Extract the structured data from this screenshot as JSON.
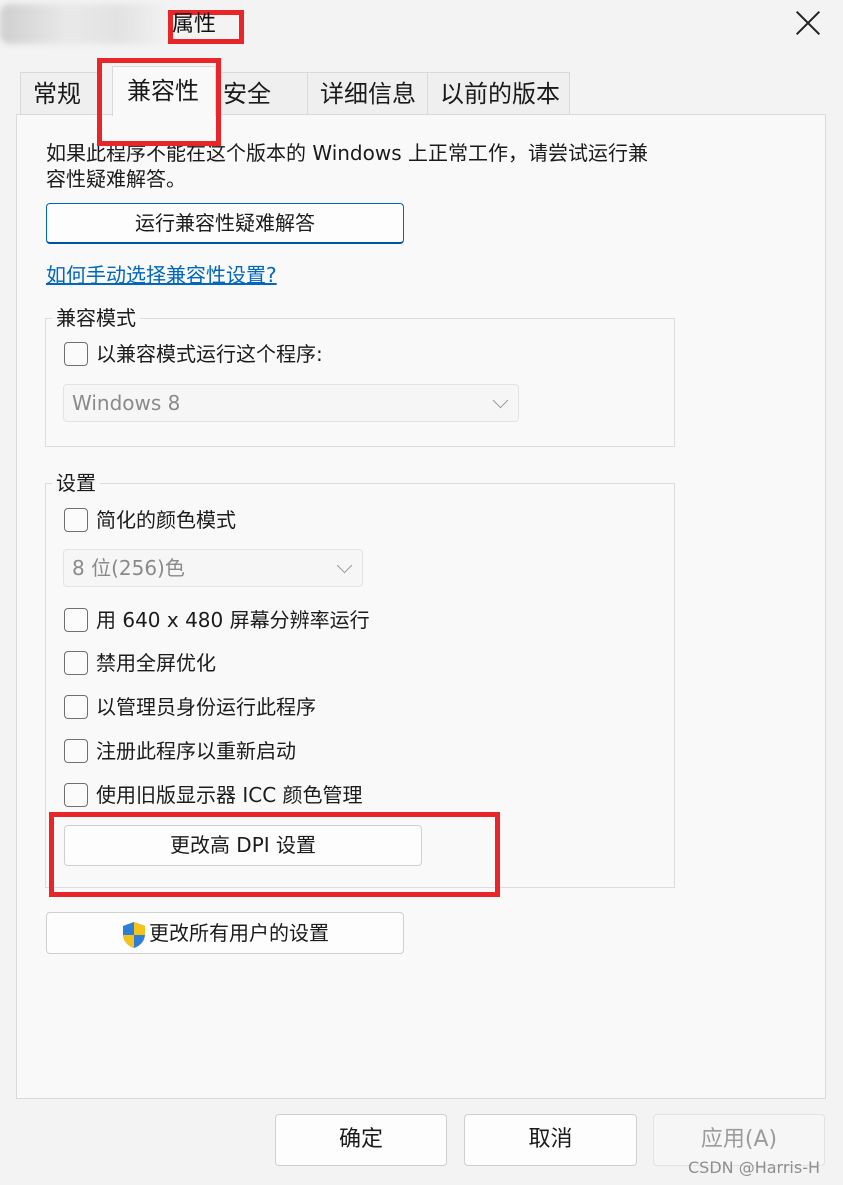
{
  "window": {
    "title": "属性"
  },
  "tabs": [
    {
      "label": "常规"
    },
    {
      "label": "兼容性"
    },
    {
      "label": "安全"
    },
    {
      "label": "详细信息"
    },
    {
      "label": "以前的版本"
    }
  ],
  "intro": {
    "line1": "如果此程序不能在这个版本的 Windows 上正常工作，请尝试运行兼",
    "line2": "容性疑难解答。"
  },
  "troubleshoot_button": "运行兼容性疑难解答",
  "manual_link": "如何手动选择兼容性设置?",
  "compat_mode": {
    "legend": "兼容模式",
    "checkbox_label": "以兼容模式运行这个程序:",
    "select_value": "Windows 8"
  },
  "settings": {
    "legend": "设置",
    "reduced_color_label": "简化的颜色模式",
    "color_select_value": "8 位(256)色",
    "items": [
      {
        "label": "用 640 x 480 屏幕分辨率运行"
      },
      {
        "label": "禁用全屏优化"
      },
      {
        "label": "以管理员身份运行此程序"
      },
      {
        "label": "注册此程序以重新启动"
      },
      {
        "label": "使用旧版显示器 ICC 颜色管理"
      }
    ],
    "dpi_button": "更改高 DPI 设置"
  },
  "all_users_button": "更改所有用户的设置",
  "footer": {
    "ok": "确定",
    "cancel": "取消",
    "apply": "应用(A)"
  },
  "watermark": "CSDN @Harris-H",
  "colors": {
    "accent": "#0067c0",
    "highlight_red": "#e8262a"
  }
}
